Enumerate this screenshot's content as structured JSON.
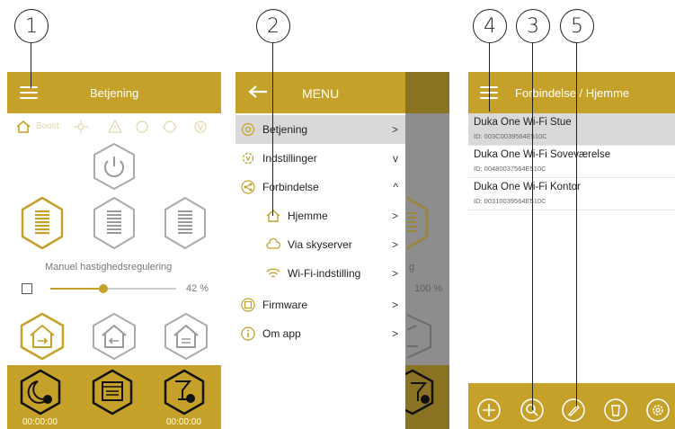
{
  "callouts": [
    "1",
    "2",
    "3",
    "4",
    "5"
  ],
  "colors": {
    "accent": "#c5a12a",
    "selected_row": "#d9d9d9",
    "white": "#ffffff"
  },
  "screen1": {
    "header_title": "Betjening",
    "tabs": [
      "Boost"
    ],
    "speed_label": "Manuel hastighedsregulering",
    "speed_value": 0.42,
    "speed_text": "42 %",
    "timers": [
      "00:00:00",
      "00:00:00"
    ],
    "icons": [
      "menu-icon",
      "home-tab-icon",
      "fan-tab-icon",
      "alert-tab-icon",
      "power-icon",
      "speed-1-icon",
      "speed-2-icon",
      "speed-3-icon",
      "mode-exhaust-icon",
      "mode-ventilation-icon",
      "mode-supply-icon",
      "night-timer-icon",
      "schedule-icon",
      "party-timer-icon"
    ]
  },
  "screen2": {
    "header_title": "MENU",
    "items": [
      {
        "label": "Betjening",
        "icon": "betjening-icon",
        "chev": ">"
      },
      {
        "label": "Indstillinger",
        "icon": "settings-icon",
        "chev": "v"
      },
      {
        "label": "Forbindelse",
        "icon": "connection-icon",
        "chev": "^"
      },
      {
        "label": "Hjemme",
        "icon": "home-icon",
        "chev": ">"
      },
      {
        "label": "Via skyserver",
        "icon": "cloud-icon",
        "chev": ">"
      },
      {
        "label": "Wi-Fi-indstilling",
        "icon": "wifi-icon",
        "chev": ">"
      },
      {
        "label": "Firmware",
        "icon": "firmware-icon",
        "chev": ">"
      },
      {
        "label": "Om app",
        "icon": "info-icon",
        "chev": ">"
      }
    ],
    "behind_fragments": {
      "g": "g",
      "pct": "100 %"
    }
  },
  "screen3": {
    "header_title": "Forbindelse / Hjemme",
    "devices": [
      {
        "name": "Duka One Wi-Fi Stue",
        "id": "ID: 003C0039564E510C"
      },
      {
        "name": "Duka One Wi-Fi Soveværelse",
        "id": "ID: 00480037564E510C"
      },
      {
        "name": "Duka One Wi-Fi Kontor",
        "id": "ID: 00310039564E510C"
      }
    ],
    "toolbar": [
      "add-icon",
      "search-icon",
      "edit-icon",
      "delete-icon",
      "settings-icon"
    ]
  }
}
